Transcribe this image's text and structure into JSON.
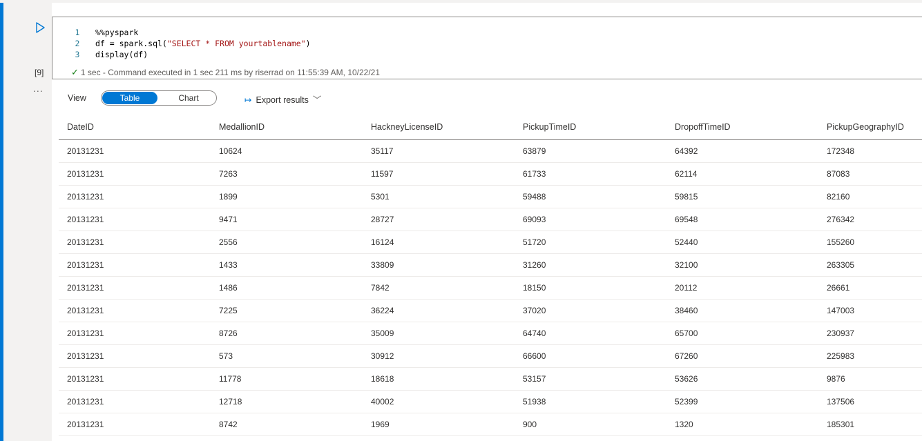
{
  "cell": {
    "execution_count": "[9]",
    "more_label": "...",
    "code_lines": [
      {
        "num": "1",
        "parts": [
          {
            "t": "%%pyspark",
            "cls": ""
          }
        ]
      },
      {
        "num": "2",
        "parts": [
          {
            "t": "df = spark.sql(",
            "cls": ""
          },
          {
            "t": "\"SELECT * FROM yourtablename\"",
            "cls": "str"
          },
          {
            "t": ")",
            "cls": ""
          }
        ]
      },
      {
        "num": "3",
        "parts": [
          {
            "t": "display(df)",
            "cls": ""
          }
        ]
      }
    ],
    "status_text": "1 sec - Command executed in 1 sec 211 ms by riserrad on 11:55:39 AM, 10/22/21"
  },
  "output": {
    "view_label": "View",
    "view_options": {
      "table": "Table",
      "chart": "Chart"
    },
    "selected_view": "Table",
    "export_label": "Export results",
    "columns": [
      "DateID",
      "MedallionID",
      "HackneyLicenseID",
      "PickupTimeID",
      "DropoffTimeID",
      "PickupGeographyID"
    ],
    "rows": [
      [
        "20131231",
        "10624",
        "35117",
        "63879",
        "64392",
        "172348"
      ],
      [
        "20131231",
        "7263",
        "11597",
        "61733",
        "62114",
        "87083"
      ],
      [
        "20131231",
        "1899",
        "5301",
        "59488",
        "59815",
        "82160"
      ],
      [
        "20131231",
        "9471",
        "28727",
        "69093",
        "69548",
        "276342"
      ],
      [
        "20131231",
        "2556",
        "16124",
        "51720",
        "52440",
        "155260"
      ],
      [
        "20131231",
        "1433",
        "33809",
        "31260",
        "32100",
        "263305"
      ],
      [
        "20131231",
        "1486",
        "7842",
        "18150",
        "20112",
        "26661"
      ],
      [
        "20131231",
        "7225",
        "36224",
        "37020",
        "38460",
        "147003"
      ],
      [
        "20131231",
        "8726",
        "35009",
        "64740",
        "65700",
        "230937"
      ],
      [
        "20131231",
        "573",
        "30912",
        "66600",
        "67260",
        "225983"
      ],
      [
        "20131231",
        "11778",
        "18618",
        "53157",
        "53626",
        "9876"
      ],
      [
        "20131231",
        "12718",
        "40002",
        "51938",
        "52399",
        "137506"
      ],
      [
        "20131231",
        "8742",
        "1969",
        "900",
        "1320",
        "185301"
      ]
    ]
  },
  "colors": {
    "accent": "#0078d4",
    "success": "#107c10",
    "string": "#a31515"
  }
}
